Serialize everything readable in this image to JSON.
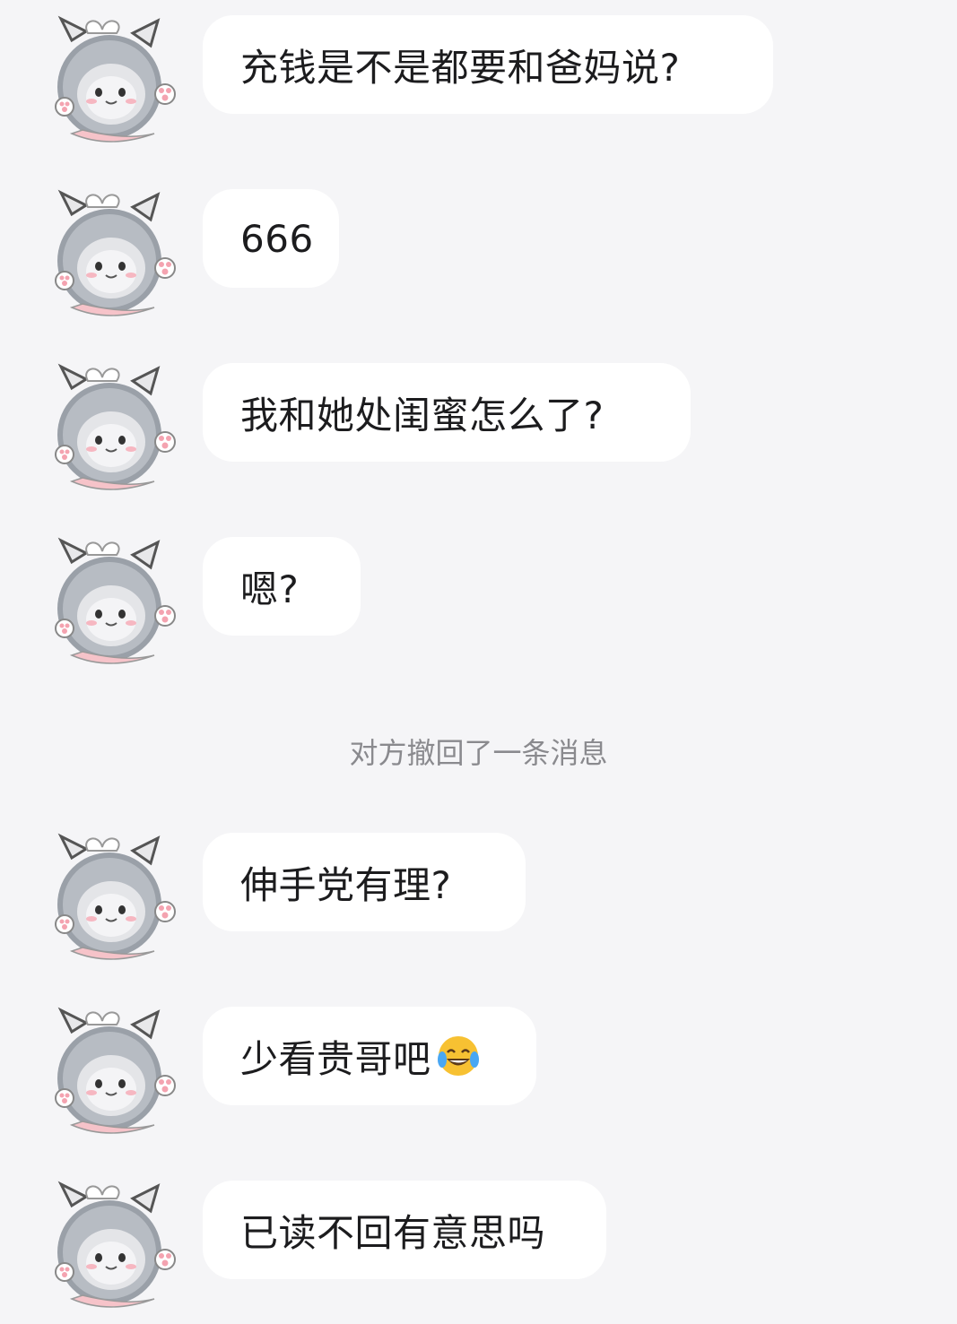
{
  "messages": [
    {
      "text": "充钱是不是都要和爸妈说?"
    },
    {
      "text": "666"
    },
    {
      "text": "我和她处闺蜜怎么了?"
    },
    {
      "text": "嗯?"
    },
    {
      "text": "伸手党有理?"
    },
    {
      "text": "少看贵哥吧",
      "emoji": "face-with-tears-of-joy"
    },
    {
      "text": "已读不回有意思吗"
    }
  ],
  "system_note": "对方撤回了一条消息",
  "colors": {
    "background": "#f5f5f7",
    "bubble": "#ffffff",
    "text": "#1c1c1e",
    "system_text": "#8a8a8e"
  }
}
